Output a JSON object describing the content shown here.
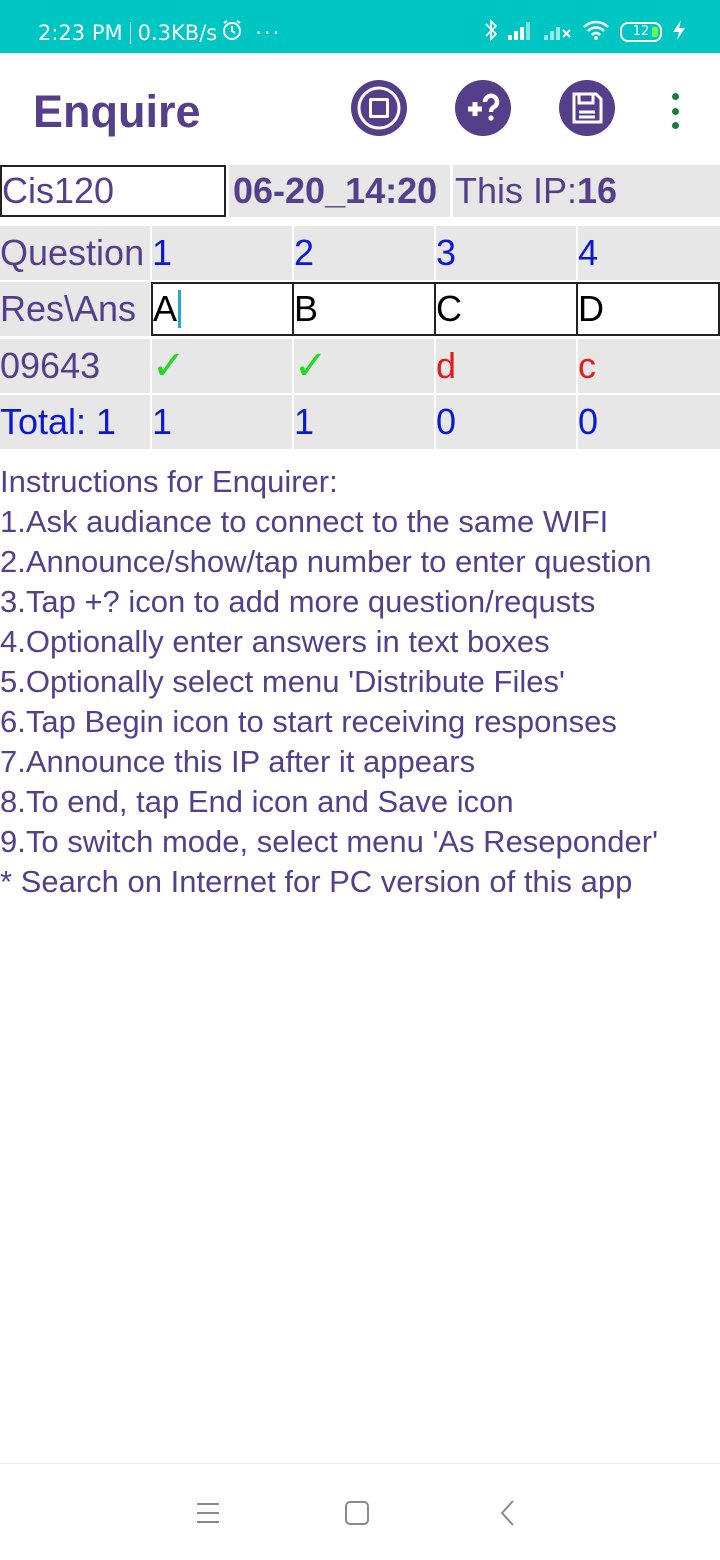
{
  "status_bar": {
    "time": "2:23 PM",
    "speed": "0.3KB/s",
    "more": "···",
    "battery": "12",
    "icons": [
      "alarm-icon",
      "bluetooth-icon",
      "signal-icon",
      "signal-no-service-icon",
      "wifi-icon",
      "battery-icon",
      "charging-icon"
    ]
  },
  "app_bar": {
    "title": "Enquire",
    "actions": [
      "stop-icon",
      "add-question-icon",
      "save-icon",
      "overflow-menu-icon"
    ],
    "accent": "#553f8a"
  },
  "info": {
    "course": "Cis120",
    "session": "06-20_14:20",
    "ip_label": "This IP:",
    "ip_value": "16"
  },
  "grid": {
    "question_label": "Question",
    "questions": [
      "1",
      "2",
      "3",
      "4"
    ],
    "answers_label": "Res\\Ans",
    "answers": [
      "A",
      "B",
      "C",
      "D"
    ],
    "responses": [
      {
        "id": "09643",
        "results": [
          "✓",
          "✓",
          "d",
          "c"
        ]
      }
    ],
    "total_label": "Total: 1",
    "totals": [
      "1",
      "1",
      "0",
      "0"
    ]
  },
  "instructions": [
    "Instructions for Enquirer:",
    "1.Ask audiance to connect to the same WIFI",
    "2.Announce/show/tap number to enter question",
    "3.Tap +? icon to add more question/requsts",
    "4.Optionally enter answers in text boxes",
    "5.Optionally select menu 'Distribute Files'",
    "6.Tap Begin icon to start receiving responses",
    "7.Announce this IP after it appears",
    "8.To end, tap End icon and Save icon",
    "9.To switch mode, select menu 'As Reseponder'",
    "* Search on Internet for PC version of this app"
  ],
  "nav_bar": [
    "menu-icon",
    "home-icon",
    "back-icon"
  ],
  "colors": {
    "status_bar": "#00c6c3",
    "text_primary": "#553f8a",
    "blue": "#0c16d6",
    "correct": "#1fdc1f",
    "wrong": "#e31b1b",
    "cell_bg": "#e7e7e7"
  }
}
